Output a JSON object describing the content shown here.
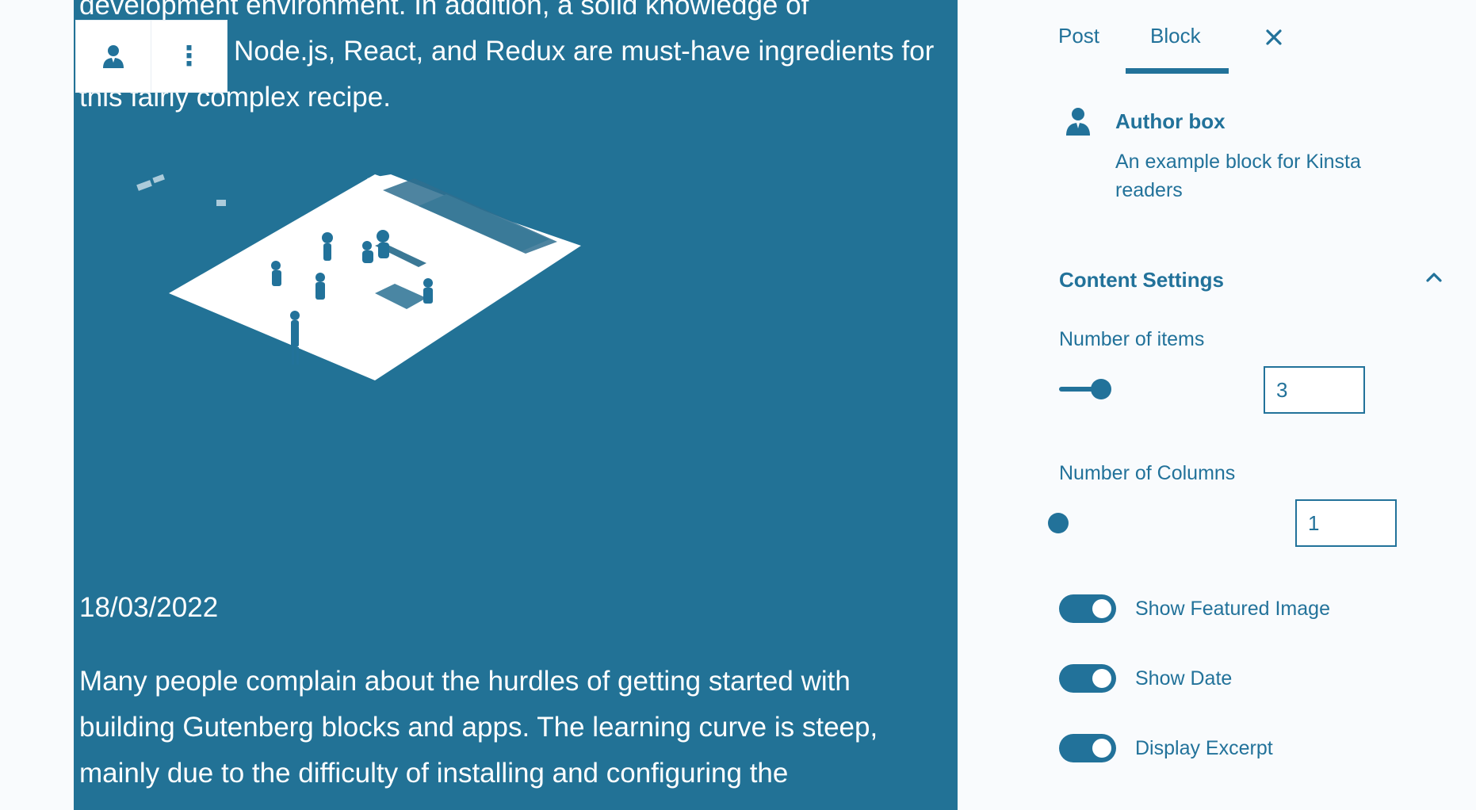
{
  "editor": {
    "paragraph_top_line1": "development environment. In addition, a solid knowledge of",
    "paragraph_top_line2_visible": "Node.js, React, and Redux are must-have ingredients for",
    "paragraph_top_line3": "this fairly complex recipe.",
    "post_date": "18/03/2022",
    "paragraph_bottom_line1": "Many people complain about the hurdles of getting started with",
    "paragraph_bottom_line2": "building Gutenberg blocks and apps. The learning curve is steep,",
    "paragraph_bottom_line3": "mainly due to the difficulty of installing and configuring the",
    "toolbar": {
      "block_icon": "author-icon",
      "options_icon": "more-vertical-icon",
      "options_glyph": "⋮"
    }
  },
  "sidebar": {
    "tabs": [
      {
        "label": "Post",
        "active": false
      },
      {
        "label": "Block",
        "active": true
      }
    ],
    "close_icon": "close-icon",
    "block_card": {
      "icon": "author-icon",
      "title": "Author box",
      "description": "An example block for Kinsta readers"
    },
    "panel": {
      "title": "Content Settings",
      "expanded": true,
      "number_of_items": {
        "label": "Number of items",
        "value": "3"
      },
      "number_of_columns": {
        "label": "Number of Columns",
        "value": "1"
      },
      "toggles": [
        {
          "label": "Show Featured Image",
          "on": true
        },
        {
          "label": "Show Date",
          "on": true
        },
        {
          "label": "Display Excerpt",
          "on": true
        }
      ]
    }
  },
  "colors": {
    "accent": "#22729a",
    "block_background": "#227296",
    "sidebar_background": "#f9fbfd",
    "text_on_block": "#ffffff"
  }
}
